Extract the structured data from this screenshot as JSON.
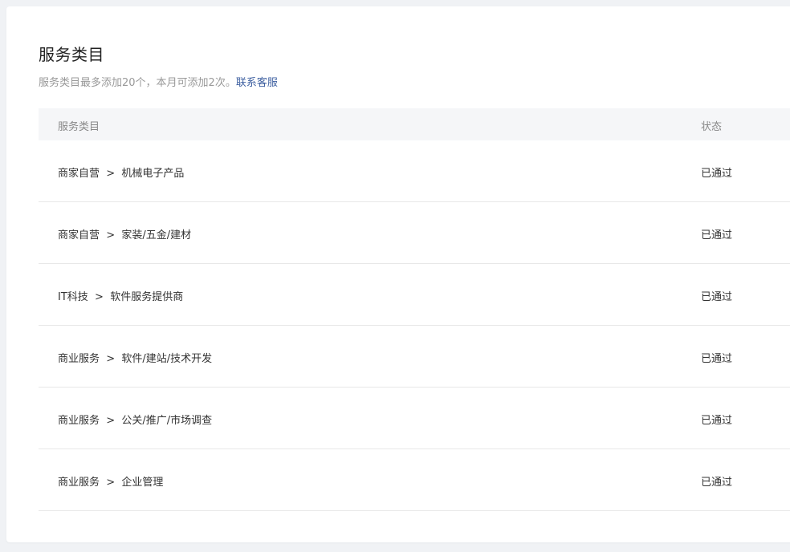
{
  "page": {
    "title": "服务类目",
    "subtitle_text": "服务类目最多添加20个，本月可添加2次。",
    "contact_link": "联系客服"
  },
  "table": {
    "headers": [
      "服务类目",
      "状态"
    ],
    "rows": [
      {
        "category": "商家自营  >  机械电子产品",
        "status": "已通过"
      },
      {
        "category": "商家自营  >  家装/五金/建材",
        "status": "已通过"
      },
      {
        "category": "IT科技  >  软件服务提供商",
        "status": "已通过"
      },
      {
        "category": "商业服务  >  软件/建站/技术开发",
        "status": "已通过"
      },
      {
        "category": "商业服务  >  公关/推广/市场调查",
        "status": "已通过"
      },
      {
        "category": "商业服务  >  企业管理",
        "status": "已通过"
      }
    ]
  },
  "colors": {
    "link": "#3d5fa0",
    "header_bg": "#f5f6f8",
    "page_bg": "#f0f2f5"
  }
}
